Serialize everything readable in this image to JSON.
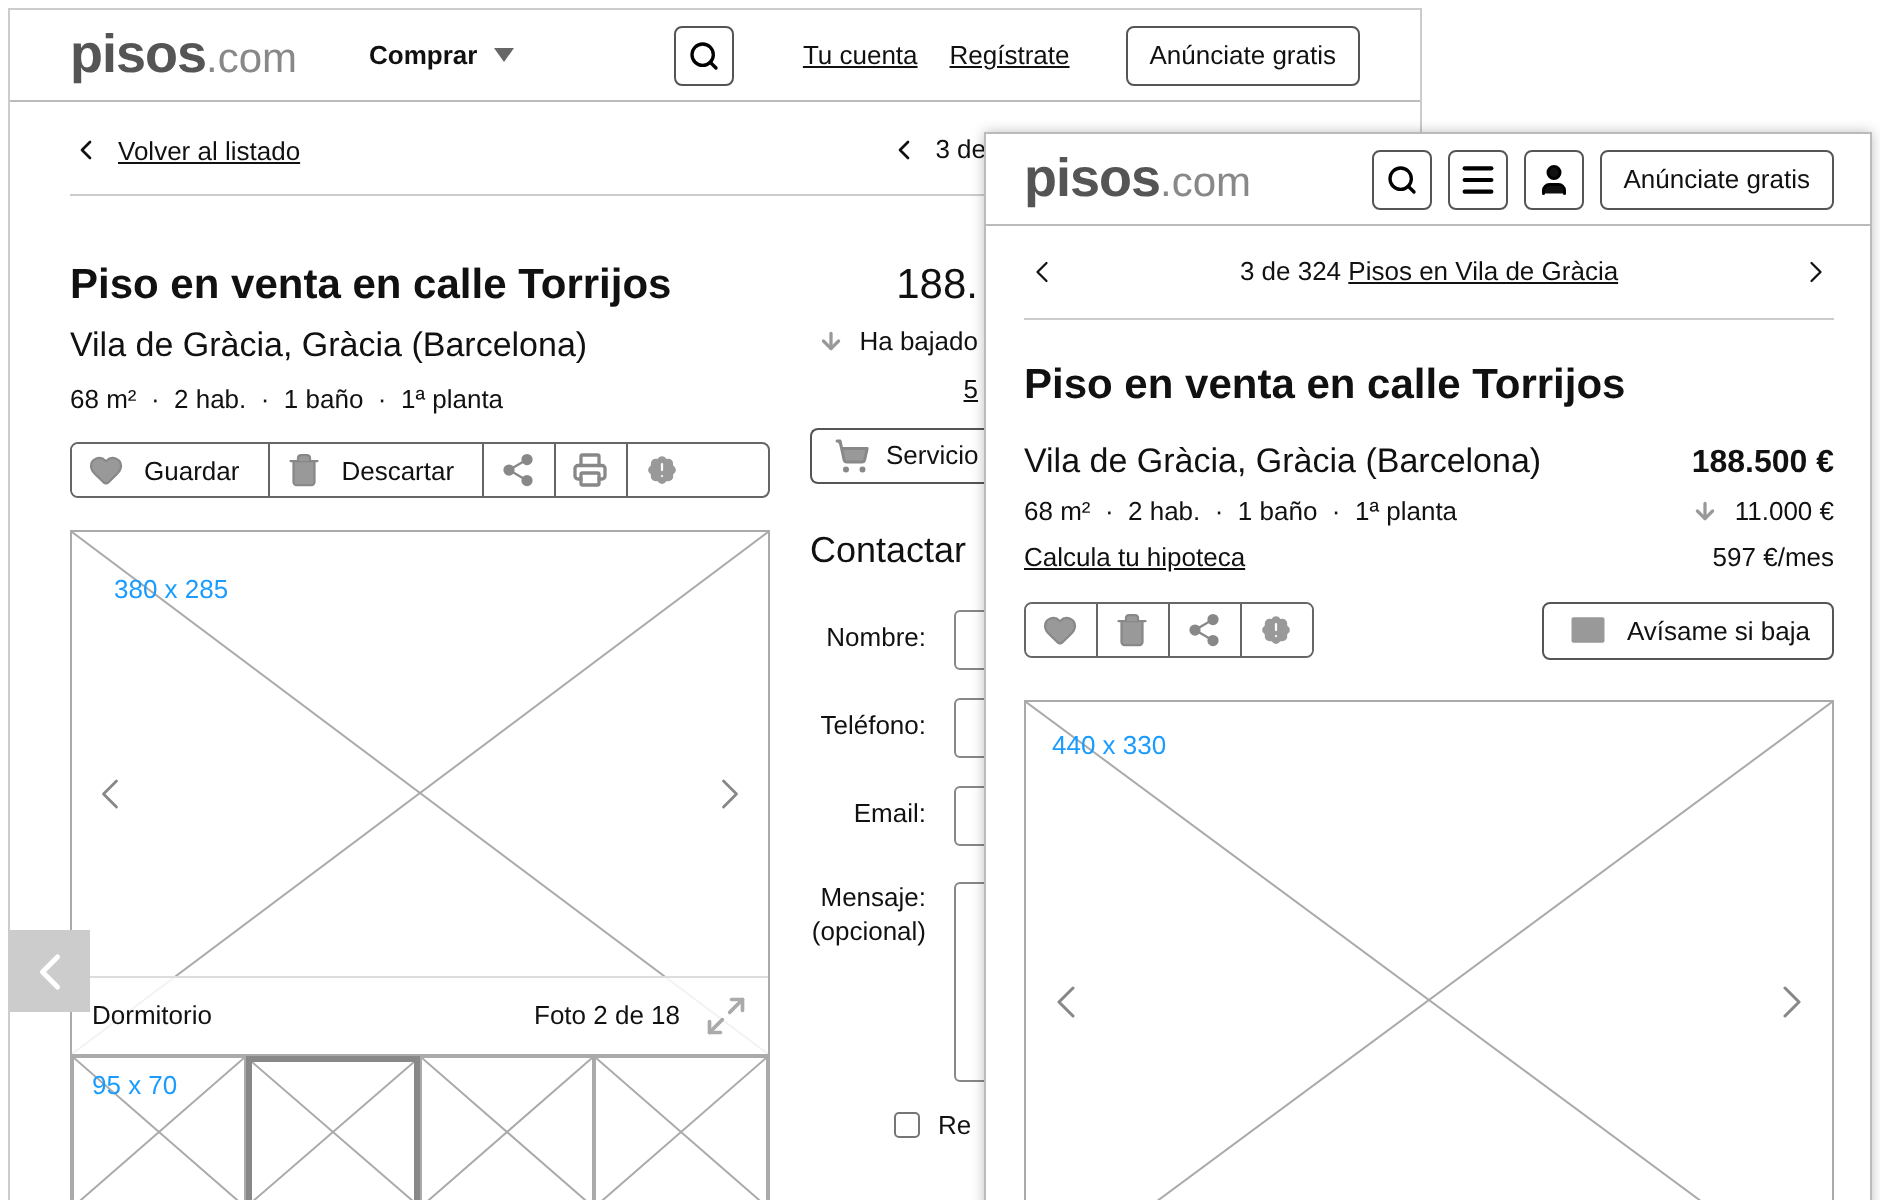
{
  "desktop": {
    "header": {
      "logo": {
        "brand": "pisos",
        "suffix": ".com"
      },
      "menu": "Comprar",
      "links": [
        "Tu cuenta",
        "Regístrate"
      ],
      "cta": "Anúnciate gratis"
    },
    "back_link": "Volver al listado",
    "pager": "3 de",
    "title": "Piso en venta en calle Torrijos",
    "location": "Vila de Gràcia, Gràcia (Barcelona)",
    "specs": "68 m²  ·  2 hab.  ·  1 baño  ·  1ª planta",
    "price": "188.",
    "price_drop": "Ha bajado",
    "monthly": "5",
    "actions": [
      {
        "kind": "favorite",
        "label": "Guardar"
      },
      {
        "kind": "discard",
        "label": "Descartar"
      },
      {
        "kind": "share"
      },
      {
        "kind": "print"
      },
      {
        "kind": "report"
      }
    ],
    "services_button": "Servicio",
    "gallery": {
      "size_label": "380 x 285",
      "caption": "Dormitorio",
      "counter": "Foto 2 de 18",
      "thumbnails": [
        {
          "size_label": "95 x 70",
          "selected": false
        },
        {
          "selected": true
        },
        {
          "selected": false
        },
        {
          "selected": false
        }
      ]
    },
    "contact": {
      "title": "Contactar",
      "fields": [
        {
          "label": "Nombre:",
          "kind": "input"
        },
        {
          "label": "Teléfono:",
          "kind": "input"
        },
        {
          "label": "Email:",
          "kind": "input"
        },
        {
          "label": "Mensaje:",
          "note": "(opcional)",
          "kind": "textarea"
        }
      ],
      "checkbox": {
        "label": "Re",
        "checked": false
      }
    }
  },
  "mobile": {
    "header": {
      "logo": {
        "brand": "pisos",
        "suffix": ".com"
      },
      "cta": "Anúnciate gratis"
    },
    "pager": {
      "counter": "3 de 324",
      "link": "Pisos en Vila de Gràcia"
    },
    "title": "Piso en venta en calle Torrijos",
    "location": "Vila de Gràcia, Gràcia (Barcelona)",
    "price": "188.500 €",
    "specs": "68 m²  ·  2 hab.  ·  1 baño  ·  1ª planta",
    "price_drop": "11.000 €",
    "mortgage_link": "Calcula tu hipoteca",
    "monthly": "597 €/mes",
    "actions": [
      {
        "kind": "favorite"
      },
      {
        "kind": "discard"
      },
      {
        "kind": "share"
      },
      {
        "kind": "report"
      }
    ],
    "alert_button": "Avísame si baja",
    "gallery": {
      "size_label": "440 x 330"
    }
  }
}
